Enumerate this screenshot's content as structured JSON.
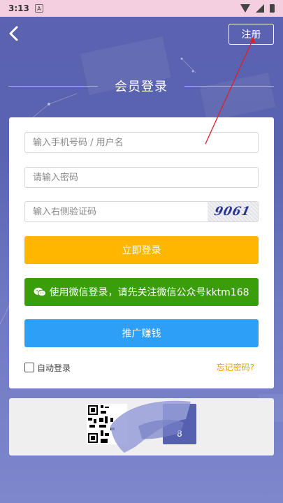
{
  "status_bar": {
    "time": "3:13",
    "notification_icon": "A"
  },
  "header": {
    "register_label": "注册",
    "title": "会员登录"
  },
  "form": {
    "username_placeholder": "输入手机号码 / 用户名",
    "password_placeholder": "请输入密码",
    "captcha_placeholder": "输入右侧验证码",
    "captcha_text": "9061",
    "login_label": "立即登录",
    "wechat_label": "使用微信登录，请先关注微信公众号kktm168",
    "promo_label": "推广赚钱",
    "auto_login_label": "自动登录",
    "forgot_label": "忘记密码?"
  },
  "banner": {
    "card_number": "8"
  },
  "colors": {
    "login": "#ffb600",
    "wechat": "#3a9e0b",
    "promo": "#2d9ff6",
    "forgot": "#e9a400"
  }
}
